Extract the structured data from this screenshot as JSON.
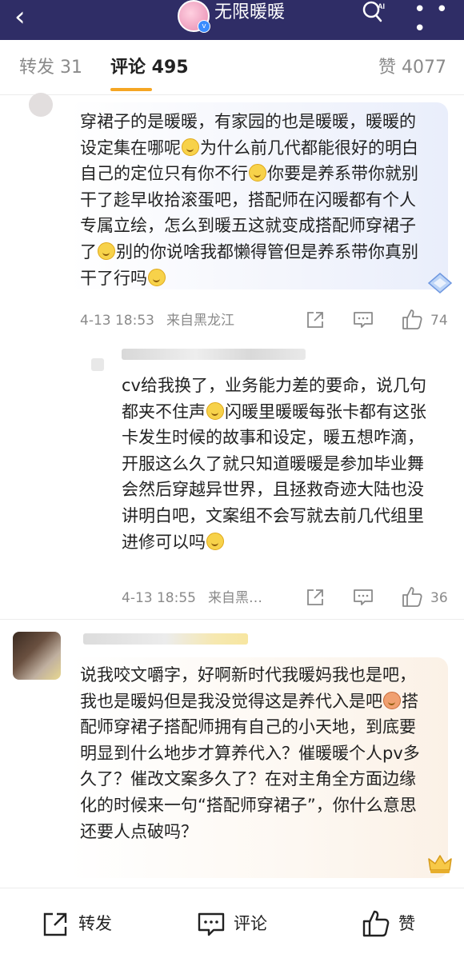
{
  "header": {
    "back_glyph": "‹",
    "title": "无限暖暖",
    "ai_label": "AI",
    "more_glyph": "⋮",
    "verified_mark": "v"
  },
  "tabs": [
    {
      "label": "转发 31"
    },
    {
      "label": "评论 495"
    },
    {
      "label": "赞 4077"
    }
  ],
  "comments": [
    {
      "segments": [
        "穿裙子的是暖暖，有家园的也是暖暖，暖暖的设定集在哪呢",
        "为什么前几代都能很好的明白自己的定位只有你不行",
        "你要是养系带你就别干了趁早收拾滚蛋吧，搭配师在闪暖都有个人专属立绘，怎么到暖五这就变成搭配师穿裙子了",
        "别的你说啥我都懒得管但是养系带你真别干了行吗"
      ],
      "time": "4-13 18:53",
      "location": "来自黑龙江",
      "likes": "74"
    },
    {
      "segments": [
        "cv给我换了，业务能力差的要命，说几句都夹不住声",
        "闪暖里暖暖每张卡都有这张卡发生时候的故事和设定，暖五想咋滴，开服这么久了就只知道暖暖是参加毕业舞会然后穿越异世界，且拯救奇迹大陆也没讲明白吧，文案组不会写就去前几代组里进修可以吗"
      ],
      "time": "4-13 18:55",
      "location": "来自黑…",
      "likes": "36"
    },
    {
      "segments": [
        "说我咬文嚼字，好啊新时代我暖妈我也是吧，我也是暖妈但是我没觉得这是养代入是吧",
        "搭配师穿裙子搭配师拥有自己的小天地，到底要明显到什么地步才算养代入？催暖暖个人pv多久了？催改文案多久了？在对主角全方面边缘化的时候来一句“搭配师穿裙子”，你什么意思还要人点破吗？"
      ]
    }
  ],
  "bottom_bar": {
    "repost": "转发",
    "comment": "评论",
    "like": "赞"
  },
  "colors": {
    "header_bg": "#2f2d66",
    "accent": "#f5a623",
    "bubble_blue": "#eef2fb",
    "bubble_peach": "#fbf4ec"
  }
}
